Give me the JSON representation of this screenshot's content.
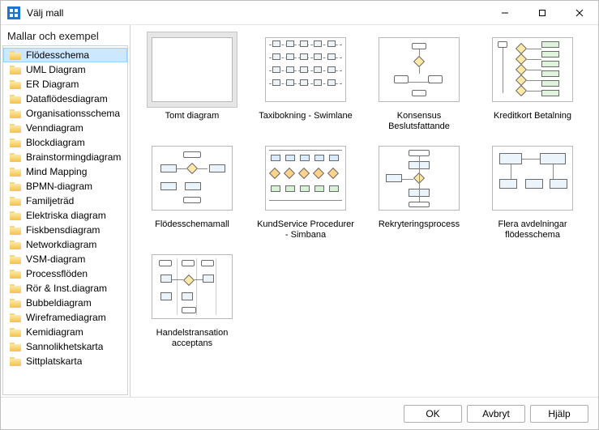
{
  "window": {
    "title": "Välj mall"
  },
  "sidebar": {
    "header": "Mallar och exempel",
    "items": [
      "Flödesschema",
      "UML Diagram",
      "ER Diagram",
      "Dataflödesdiagram",
      "Organisationsschema",
      "Venndiagram",
      "Blockdiagram",
      "Brainstormingdiagram",
      "Mind Mapping",
      "BPMN-diagram",
      "Familjeträd",
      "Elektriska diagram",
      "Fiskbensdiagram",
      "Networkdiagram",
      "VSM-diagram",
      "Processflöden",
      "Rör & Inst.diagram",
      "Bubbeldiagram",
      "Wireframediagram",
      "Kemidiagram",
      "Sannolikhetskarta",
      "Sittplatskarta"
    ],
    "selected_index": 0
  },
  "templates": [
    {
      "label": "Tomt diagram",
      "kind": "blank"
    },
    {
      "label": "Taxibokning - Swimlane",
      "kind": "swimlane"
    },
    {
      "label": "Konsensus Beslutsfattande",
      "kind": "decision"
    },
    {
      "label": "Kreditkort Betalning",
      "kind": "payment"
    },
    {
      "label": "Flödesschemamall",
      "kind": "flow"
    },
    {
      "label": "KundService Procedurer - Simbana",
      "kind": "service"
    },
    {
      "label": "Rekryteringsprocess",
      "kind": "recruit"
    },
    {
      "label": "Flera avdelningar flödesschema",
      "kind": "dept"
    },
    {
      "label": "Handelstransation acceptans",
      "kind": "trade"
    }
  ],
  "selected_template_index": 0,
  "buttons": {
    "ok": "OK",
    "cancel": "Avbryt",
    "help": "Hjälp"
  }
}
